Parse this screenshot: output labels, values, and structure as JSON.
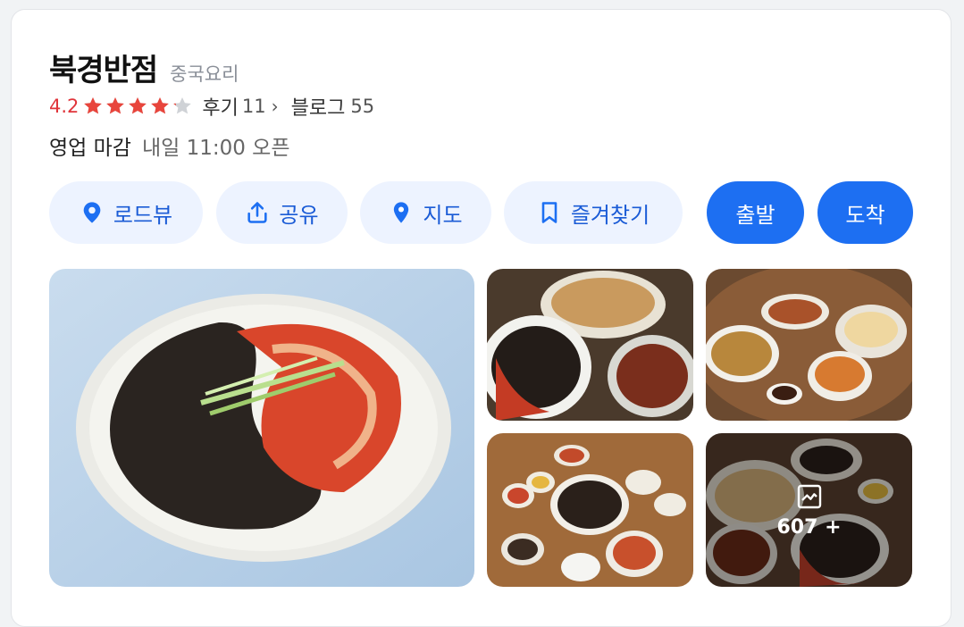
{
  "place": {
    "name": "북경반점",
    "category": "중국요리"
  },
  "rating": {
    "score": "4.2",
    "stars_filled": 4.2,
    "stars_total": 5,
    "review_label": "후기",
    "review_count": "11",
    "blog_label": "블로그",
    "blog_count": "55"
  },
  "hours": {
    "status": "영업 마감",
    "next": "내일 11:00 오픈"
  },
  "actions": {
    "roadview": "로드뷰",
    "share": "공유",
    "map": "지도",
    "favorite": "즐겨찾기",
    "depart": "출발",
    "arrive": "도착"
  },
  "photos": {
    "more_count": "607 +"
  },
  "colors": {
    "star": "#e8453c",
    "accent": "#1d6ff2",
    "soft": "#edf3ff"
  },
  "icons": [
    "pin-ring-icon",
    "share-upload-icon",
    "map-pin-icon",
    "bookmark-icon",
    "photo-gallery-icon",
    "chevron-right-icon",
    "star-icon"
  ]
}
